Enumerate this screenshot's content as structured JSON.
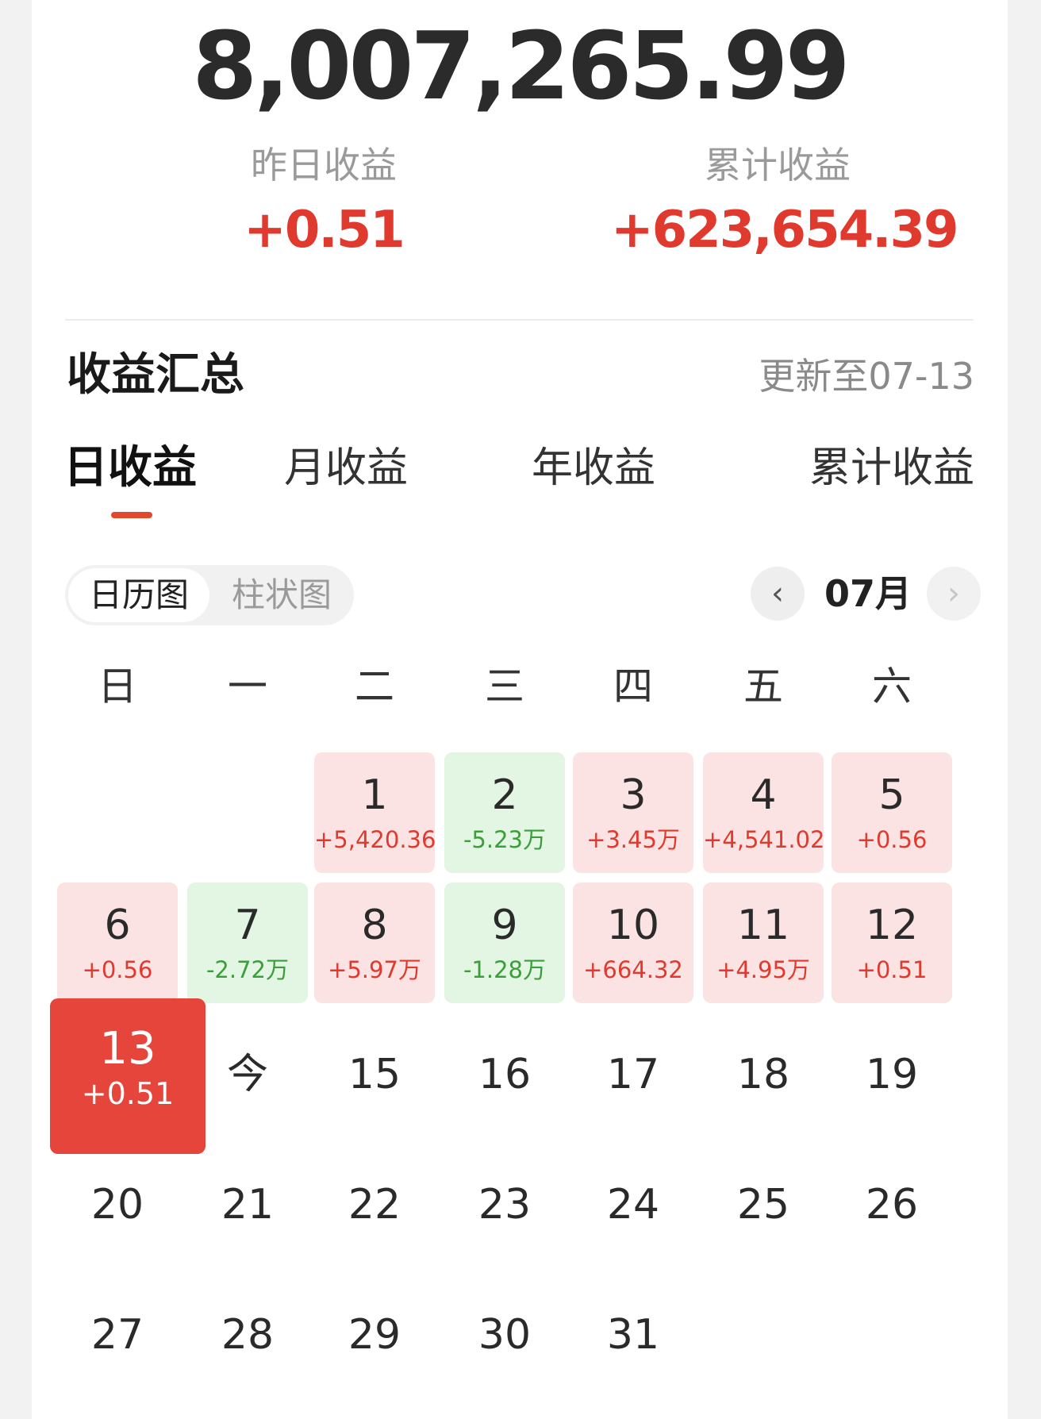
{
  "summary": {
    "total": "8,007,265.99",
    "yesterday_label": "昨日收益",
    "yesterday_value": "+0.51",
    "cumulative_label": "累计收益",
    "cumulative_value": "+623,654.39"
  },
  "section": {
    "title": "收益汇总",
    "updated": "更新至07-13"
  },
  "tabs": [
    {
      "label": "日收益",
      "active": true
    },
    {
      "label": "月收益",
      "active": false
    },
    {
      "label": "年收益",
      "active": false
    },
    {
      "label": "累计收益",
      "active": false
    }
  ],
  "view_toggle": {
    "calendar": "日历图",
    "bar": "柱状图"
  },
  "month_nav": {
    "month": "07月",
    "prev_icon": "chevron-left-icon",
    "next_icon": "chevron-right-icon"
  },
  "weekdays": [
    "日",
    "一",
    "二",
    "三",
    "四",
    "五",
    "六"
  ],
  "calendar": {
    "first_weekday": 2,
    "days": [
      {
        "day": "1",
        "gain": "+5,420.36",
        "kind": "pos"
      },
      {
        "day": "2",
        "gain": "-5.23万",
        "kind": "neg"
      },
      {
        "day": "3",
        "gain": "+3.45万",
        "kind": "pos"
      },
      {
        "day": "4",
        "gain": "+4,541.02",
        "kind": "pos"
      },
      {
        "day": "5",
        "gain": "+0.56",
        "kind": "pos"
      },
      {
        "day": "6",
        "gain": "+0.56",
        "kind": "pos"
      },
      {
        "day": "7",
        "gain": "-2.72万",
        "kind": "neg"
      },
      {
        "day": "8",
        "gain": "+5.97万",
        "kind": "pos"
      },
      {
        "day": "9",
        "gain": "-1.28万",
        "kind": "neg"
      },
      {
        "day": "10",
        "gain": "+664.32",
        "kind": "pos"
      },
      {
        "day": "11",
        "gain": "+4.95万",
        "kind": "pos"
      },
      {
        "day": "12",
        "gain": "+0.51",
        "kind": "pos"
      },
      {
        "day": "13",
        "gain": "+0.51",
        "kind": "selected"
      },
      {
        "day": "今",
        "gain": "",
        "kind": "plain"
      },
      {
        "day": "15",
        "gain": "",
        "kind": "plain"
      },
      {
        "day": "16",
        "gain": "",
        "kind": "plain"
      },
      {
        "day": "17",
        "gain": "",
        "kind": "plain"
      },
      {
        "day": "18",
        "gain": "",
        "kind": "plain"
      },
      {
        "day": "19",
        "gain": "",
        "kind": "plain"
      },
      {
        "day": "20",
        "gain": "",
        "kind": "plain"
      },
      {
        "day": "21",
        "gain": "",
        "kind": "plain"
      },
      {
        "day": "22",
        "gain": "",
        "kind": "plain"
      },
      {
        "day": "23",
        "gain": "",
        "kind": "plain"
      },
      {
        "day": "24",
        "gain": "",
        "kind": "plain"
      },
      {
        "day": "25",
        "gain": "",
        "kind": "plain"
      },
      {
        "day": "26",
        "gain": "",
        "kind": "plain"
      },
      {
        "day": "27",
        "gain": "",
        "kind": "plain"
      },
      {
        "day": "28",
        "gain": "",
        "kind": "plain"
      },
      {
        "day": "29",
        "gain": "",
        "kind": "plain"
      },
      {
        "day": "30",
        "gain": "",
        "kind": "plain"
      },
      {
        "day": "31",
        "gain": "",
        "kind": "plain"
      }
    ]
  },
  "colors": {
    "gain_red": "#e03a2f",
    "loss_green": "#3a9f3a",
    "pos_bg": "#fbe3e3",
    "neg_bg": "#e3f5e3",
    "selected_bg": "#e5453a",
    "tab_underline": "#e0492e"
  }
}
